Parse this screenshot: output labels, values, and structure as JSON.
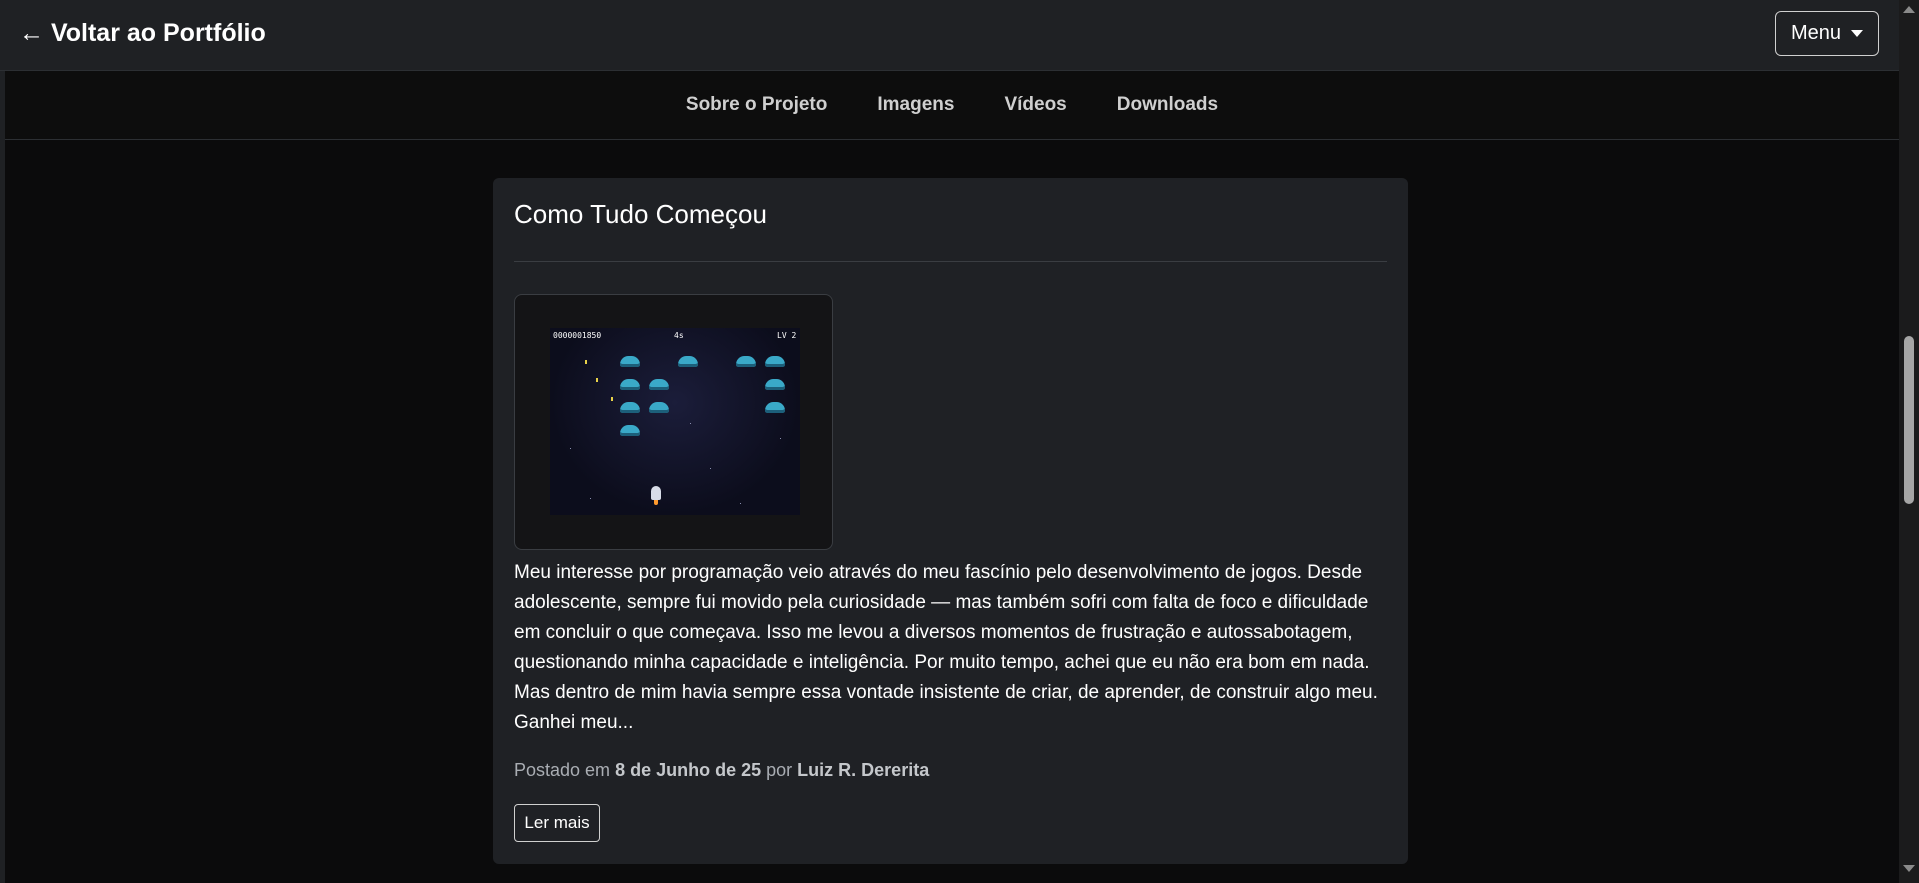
{
  "header": {
    "back_link": "← Voltar ao Portfólio",
    "menu_label": "Menu"
  },
  "subnav": {
    "items": [
      "Sobre o Projeto",
      "Imagens",
      "Vídeos",
      "Downloads"
    ]
  },
  "post": {
    "title": "Como Tudo Começou",
    "image": {
      "hud_score": "0000001850",
      "hud_timer": "4s",
      "hud_level": "LV 2"
    },
    "body": "Meu interesse por programação veio através do meu fascínio pelo desenvolvimento de jogos. Desde adolescente, sempre fui movido pela curiosidade — mas também sofri com falta de foco e dificuldade em concluir o que começava. Isso me levou a diversos momentos de frustração e autossabotagem, questionando minha capacidade e inteligência. Por muito tempo, achei que eu não era bom em nada. Mas dentro de mim havia sempre essa vontade insistente de criar, de aprender, de construir algo meu. Ganhei meu...",
    "meta": {
      "posted_in": "Postado em",
      "date": "8 de Junho de 25",
      "by": "por",
      "author": "Luiz R. Dererita"
    },
    "read_more": "Ler mais"
  },
  "icons": {
    "menu_caret": "caret-down-icon",
    "scroll_up": "scroll-up-arrow-icon",
    "scroll_down": "scroll-down-arrow-icon"
  },
  "colors": {
    "page_bg": "#0b0b0c",
    "topbar_bg": "#1f2124",
    "card_bg": "#1f2125",
    "text": "#ffffff",
    "muted": "#a9adb3"
  }
}
